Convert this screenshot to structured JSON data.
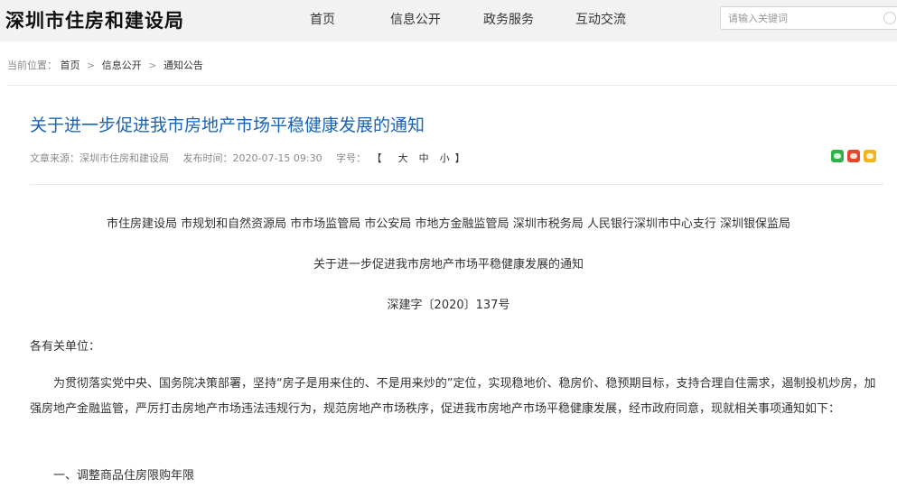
{
  "site": {
    "logo": "深圳市住房和建设局",
    "nav": [
      "首页",
      "信息公开",
      "政务服务",
      "互动交流"
    ],
    "search": {
      "placeholder": "请输入关键词"
    }
  },
  "breadcrumb": {
    "prefix": "当前位置：",
    "items": [
      "首页",
      "信息公开",
      "通知公告"
    ],
    "separator": ">"
  },
  "article": {
    "title": "关于进一步促进我市房地产市场平稳健康发展的通知",
    "source": "文章来源：深圳市住房和建设局",
    "published": "发布时间：2020-07-15 09:30",
    "font_size_label": "字号：",
    "font_size": {
      "open": "【",
      "large": "大",
      "medium": "中",
      "small": "小",
      "close": "】"
    },
    "share_icons": [
      "wechat-icon",
      "weibo-icon",
      "qzone-icon"
    ],
    "issuers": "市住房建设局 市规划和自然资源局 市市场监管局 市公安局 市地方金融监管局 深圳市税务局 人民银行深圳市中心支行 深圳银保监局",
    "doc_title": "关于进一步促进我市房地产市场平稳健康发展的通知",
    "doc_number": "深建字〔2020〕137号",
    "salutation": "各有关单位：",
    "paragraph": "为贯彻落实党中央、国务院决策部署，坚持“房子是用来住的、不是用来炒的”定位，实现稳地价、稳房价、稳预期目标，支持合理自住需求，遏制投机炒房，加强房地产金融监管，严厉打击房地产市场违法违规行为，规范房地产市场秩序，促进我市房地产市场平稳健康发展，经市政府同意，现就相关事项通知如下：",
    "section_1": "一、调整商品住房限购年限"
  },
  "colors": {
    "title_blue": "#1a63b3",
    "topbar_bg": "#f2f2f2",
    "wechat": "#2eb34a",
    "weibo": "#e6462e",
    "qzone": "#f2b41d"
  }
}
